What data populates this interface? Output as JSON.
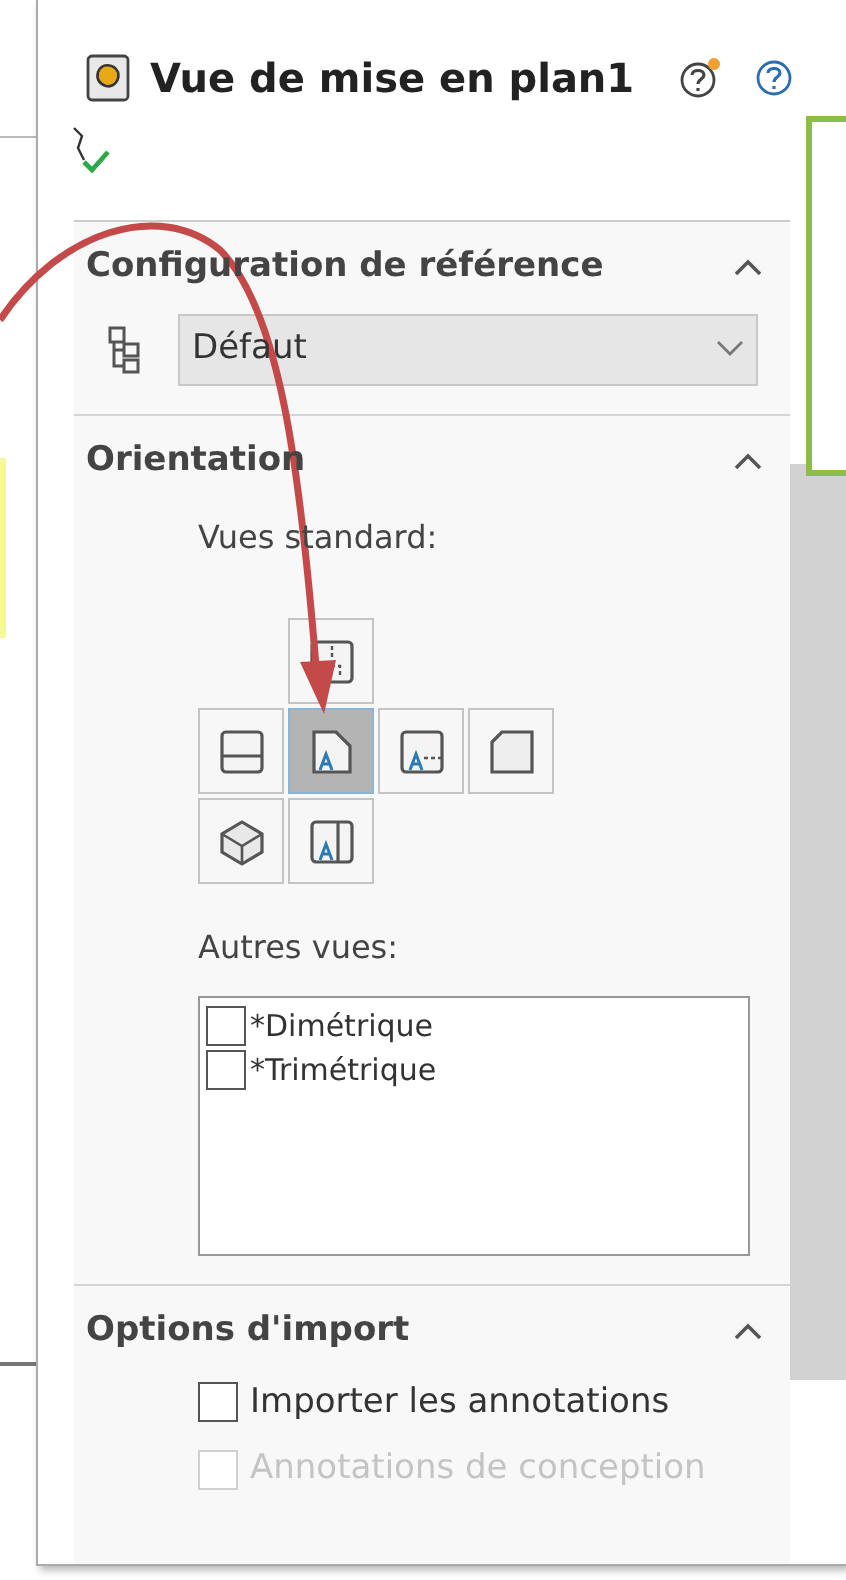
{
  "panel": {
    "title": "Vue de mise en plan1"
  },
  "sections": [
    {
      "kind": "config",
      "title": "Configuration de référence",
      "expanded": true,
      "dropdown": {
        "value": "Défaut"
      }
    },
    {
      "kind": "orientation",
      "title": "Orientation",
      "expanded": true,
      "standard_label": "Vues standard:",
      "standard_views": [
        {
          "kind": "top",
          "selected": false
        },
        {
          "kind": "bottom",
          "selected": false
        },
        {
          "kind": "front",
          "selected": true
        },
        {
          "kind": "right",
          "selected": false
        },
        {
          "kind": "back",
          "selected": false
        },
        {
          "kind": "isometric",
          "selected": false
        },
        {
          "kind": "left",
          "selected": false
        }
      ],
      "other_label": "Autres vues:",
      "other_views": [
        {
          "label": "*Dimétrique",
          "checked": false
        },
        {
          "label": "*Trimétrique",
          "checked": false
        }
      ]
    },
    {
      "kind": "import",
      "title": "Options d'import",
      "expanded": true,
      "options": [
        {
          "label": "Importer les annotations",
          "checked": false,
          "disabled": false
        },
        {
          "label": "Annotations de conception",
          "checked": false,
          "disabled": true
        }
      ]
    }
  ]
}
